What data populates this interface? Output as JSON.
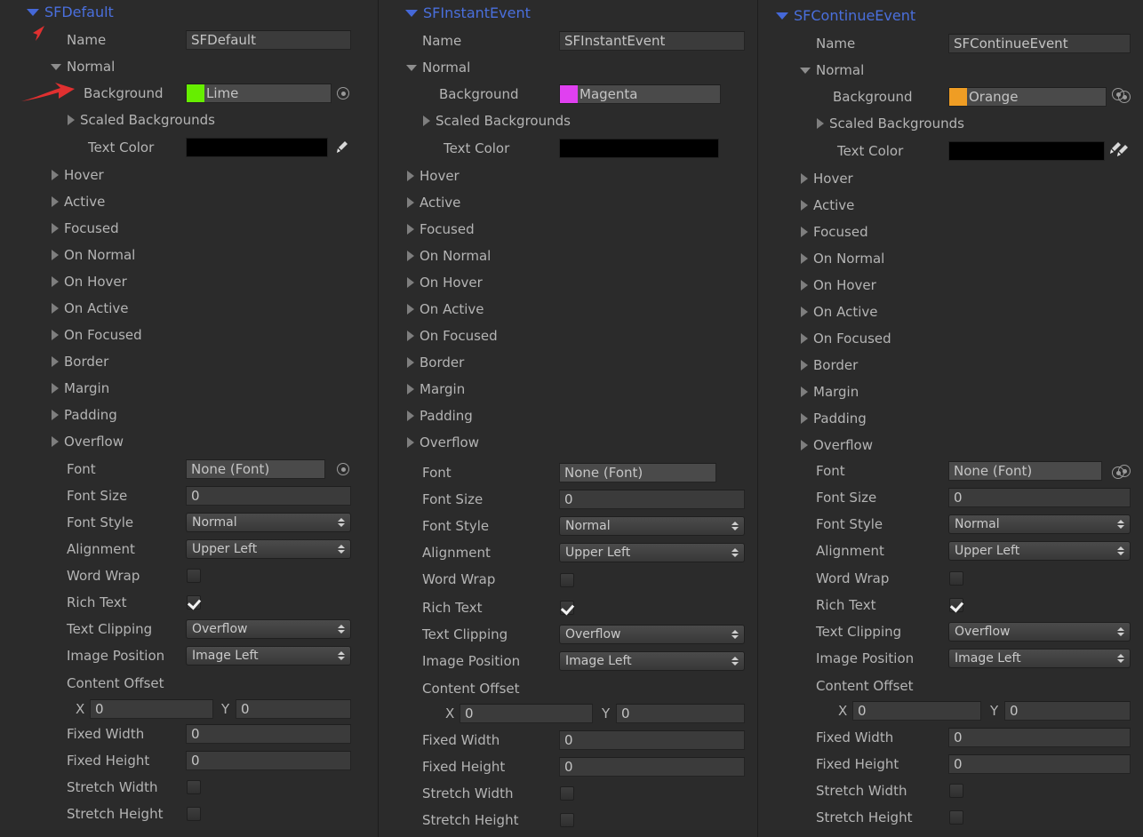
{
  "app": {
    "window": "Unity Inspector - GUIStyle Array",
    "background_color": "#2b2b2b",
    "header_color": "#4a6fdc"
  },
  "labels": {
    "name": "Name",
    "normal": "Normal",
    "background": "Background",
    "scaled_backgrounds": "Scaled Backgrounds",
    "text_color": "Text Color",
    "hover": "Hover",
    "active": "Active",
    "focused": "Focused",
    "on_normal": "On Normal",
    "on_hover": "On Hover",
    "on_active": "On Active",
    "on_focused": "On Focused",
    "border": "Border",
    "margin": "Margin",
    "padding": "Padding",
    "overflow": "Overflow",
    "font": "Font",
    "font_size": "Font Size",
    "font_style": "Font Style",
    "alignment": "Alignment",
    "word_wrap": "Word Wrap",
    "rich_text": "Rich Text",
    "text_clipping": "Text Clipping",
    "image_position": "Image Position",
    "content_offset": "Content Offset",
    "offset_x": "X",
    "offset_y": "Y",
    "fixed_width": "Fixed Width",
    "fixed_height": "Fixed Height",
    "stretch_width": "Stretch Width",
    "stretch_height": "Stretch Height"
  },
  "columns": [
    {
      "title": "SFDefault",
      "name_value": "SFDefault",
      "background_value": "Lime",
      "background_swatch": "#66ee00",
      "text_color_value": "#000000",
      "font_value": "None (Font)",
      "font_size_value": "0",
      "font_style_value": "Normal",
      "alignment_value": "Upper Left",
      "word_wrap_checked": false,
      "rich_text_checked": true,
      "text_clipping_value": "Overflow",
      "image_position_value": "Image Left",
      "offset_x_value": "0",
      "offset_y_value": "0",
      "fixed_width_value": "0",
      "fixed_height_value": "0",
      "stretch_width_checked": false,
      "stretch_height_checked": false
    },
    {
      "title": "SFInstantEvent",
      "name_value": "SFInstantEvent",
      "background_value": "Magenta",
      "background_swatch": "#e040f0",
      "text_color_value": "#000000",
      "font_value": "None (Font)",
      "font_size_value": "0",
      "font_style_value": "Normal",
      "alignment_value": "Upper Left",
      "word_wrap_checked": false,
      "rich_text_checked": true,
      "text_clipping_value": "Overflow",
      "image_position_value": "Image Left",
      "offset_x_value": "0",
      "offset_y_value": "0",
      "fixed_width_value": "0",
      "fixed_height_value": "0",
      "stretch_width_checked": false,
      "stretch_height_checked": false
    },
    {
      "title": "SFContinueEvent",
      "name_value": "SFContinueEvent",
      "background_value": "Orange",
      "background_swatch": "#ef9d24",
      "text_color_value": "#000000",
      "font_value": "None (Font)",
      "font_size_value": "0",
      "font_style_value": "Normal",
      "alignment_value": "Upper Left",
      "word_wrap_checked": false,
      "rich_text_checked": true,
      "text_clipping_value": "Overflow",
      "image_position_value": "Image Left",
      "offset_x_value": "0",
      "offset_y_value": "0",
      "fixed_width_value": "0",
      "fixed_height_value": "0",
      "stretch_width_checked": false,
      "stretch_height_checked": false
    }
  ],
  "annotations": {
    "arrow_color": "#e03030",
    "pointer_target": "Background",
    "cursor_target": "Name"
  }
}
